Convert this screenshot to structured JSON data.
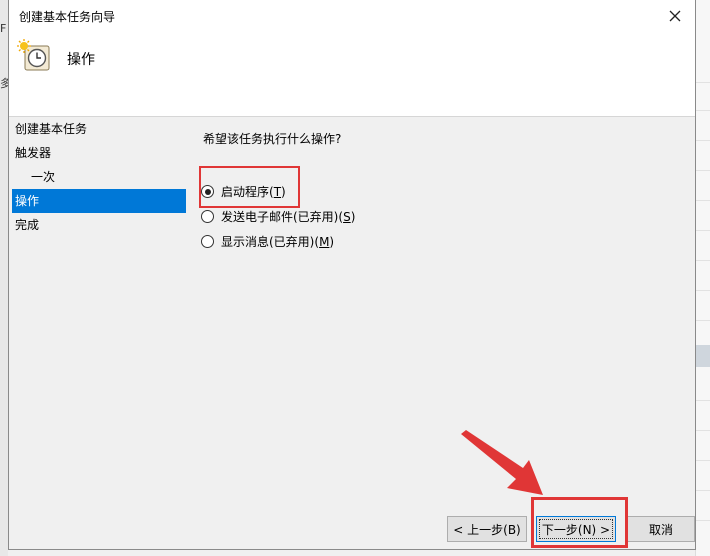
{
  "window": {
    "title": "创建基本任务向导"
  },
  "background": {
    "left_fragments": [
      "F",
      "多"
    ]
  },
  "header": {
    "title": "操作",
    "icon": "alarm-clock-task-icon"
  },
  "steps": [
    {
      "label": "创建基本任务",
      "active": false,
      "sub": false
    },
    {
      "label": "触发器",
      "active": false,
      "sub": false
    },
    {
      "label": "一次",
      "active": false,
      "sub": true
    },
    {
      "label": "操作",
      "active": true,
      "sub": false
    },
    {
      "label": "完成",
      "active": false,
      "sub": false
    }
  ],
  "question": "希望该任务执行什么操作?",
  "options": [
    {
      "label": "启动程序",
      "key": "T",
      "selected": true
    },
    {
      "label": "发送电子邮件(已弃用)",
      "key": "S",
      "selected": false
    },
    {
      "label": "显示消息(已弃用)",
      "key": "M",
      "selected": false
    }
  ],
  "buttons": {
    "back": "< 上一步(B)",
    "next": "下一步(N) >",
    "cancel": "取消"
  },
  "colors": {
    "selection": "#0078d7",
    "annotation": "#e03636"
  }
}
